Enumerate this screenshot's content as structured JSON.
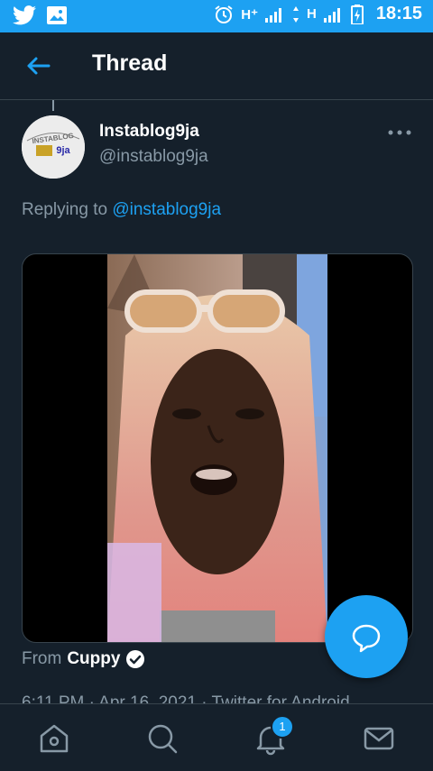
{
  "status_bar": {
    "network_1": "H⁺",
    "network_2": "H",
    "time": "18:15"
  },
  "header": {
    "title": "Thread"
  },
  "tweet": {
    "author_name": "Instablog9ja",
    "author_handle": "@instablog9ja",
    "avatar_text": "INSTABLOG 9ja",
    "replying_prefix": "Replying to",
    "replying_handle": "@instablog9ja",
    "source_prefix": "From",
    "source_name": "Cuppy",
    "meta": "6:11 PM · Apr 16, 2021 · Twitter for Android"
  },
  "bottom_nav": {
    "notifications_badge": "1"
  },
  "colors": {
    "accent": "#1da1f2",
    "background": "#15202b",
    "secondary_text": "#8899a6"
  }
}
